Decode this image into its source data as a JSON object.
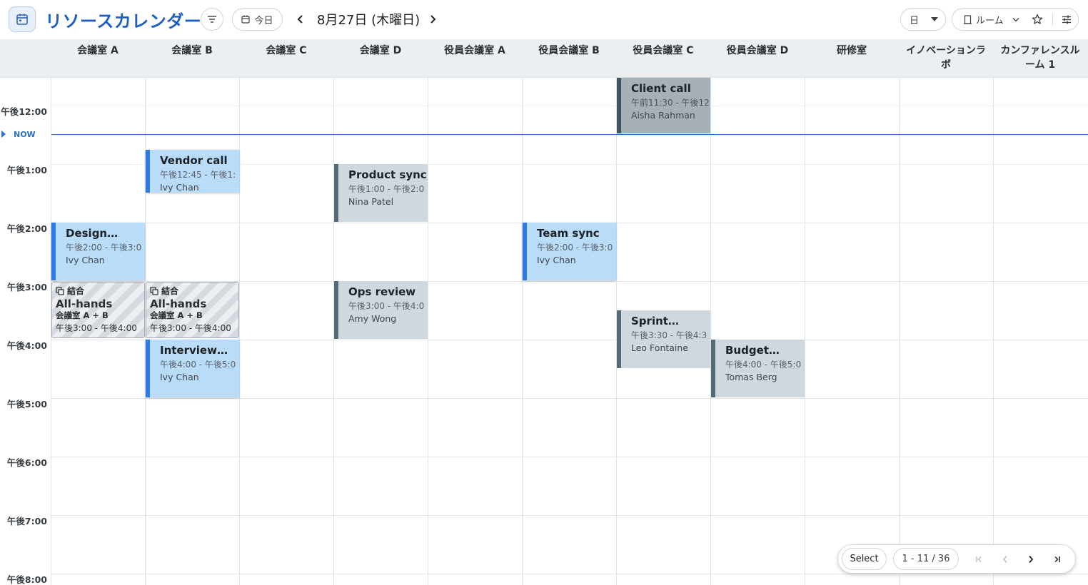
{
  "header": {
    "title": "リソースカレンダー",
    "today_label": "今日",
    "date_label": "8月27日 (木曜日)",
    "view_value": "日",
    "resource_value": "ルーム"
  },
  "columns": [
    "会議室 A",
    "会議室 B",
    "会議室 C",
    "会議室 D",
    "役員会議室 A",
    "役員会議室 B",
    "役員会議室 C",
    "役員会議室 D",
    "研修室",
    "イノベーションラボ",
    "カンファレンスルーム 1"
  ],
  "times": [
    "午後12:00",
    "午後1:00",
    "午後2:00",
    "午後3:00",
    "午後4:00",
    "午後5:00",
    "午後6:00",
    "午後7:00",
    "午後8:00"
  ],
  "now_label": "NOW",
  "events": [
    {
      "title": "Client call",
      "time": "午前11:30 - 午後12",
      "person": "Aisha Rahman"
    },
    {
      "title": "Vendor call",
      "time": "午後12:45 - 午後1:",
      "person": "Ivy Chan"
    },
    {
      "title": "Product sync",
      "time": "午後1:00 - 午後2:0",
      "person": "Nina Patel"
    },
    {
      "title": "Design…",
      "time": "午後2:00 - 午後3:0",
      "person": "Ivy Chan"
    },
    {
      "title": "Team sync",
      "time": "午後2:00 - 午後3:0",
      "person": "Ivy Chan"
    },
    {
      "title": "Ops review",
      "time": "午後3:00 - 午後4:0",
      "person": "Amy Wong"
    },
    {
      "title": "Sprint…",
      "time": "午後3:30 - 午後4:3",
      "person": "Leo Fontaine"
    },
    {
      "title": "Interview…",
      "time": "午後4:00 - 午後5:0",
      "person": "Ivy Chan"
    },
    {
      "title": "Budget…",
      "time": "午後4:00 - 午後5:0",
      "person": "Tomas Berg"
    }
  ],
  "merged": [
    {
      "badge": "結合",
      "title": "All-hands",
      "rooms": "会議室 A + B",
      "time": "午後3:00 - 午後4:00"
    },
    {
      "badge": "結合",
      "title": "All-hands",
      "rooms": "会議室 A + B",
      "time": "午後3:00 - 午後4:00"
    }
  ],
  "pager": {
    "select_label": "Select",
    "range": "1 - 11 / 36"
  },
  "colors": {
    "accent": "#1f5fbf",
    "now": "#2d6fc4",
    "event_blue": "#b9dcf9",
    "event_gray": "#cfd8de"
  },
  "icons": [
    "calendar-icon",
    "filter-icon",
    "chevron-left-icon",
    "chevron-right-icon",
    "caret-down-icon",
    "door-icon",
    "star-icon",
    "sliders-icon",
    "first-page-icon",
    "last-page-icon"
  ]
}
